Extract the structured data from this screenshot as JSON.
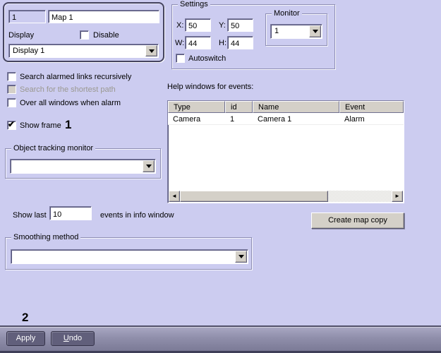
{
  "colors": {
    "background": "#ccccf0",
    "group_border_dark": "#45445f",
    "bar_gradient_top": "#a9a8c3",
    "bar_gradient_bottom": "#7b7a96",
    "bar_button_fill": "#615f7b",
    "classic_gray": "#d4d0c8",
    "disabled_text": "#9a9890"
  },
  "glyphs": {
    "check": "✔",
    "scroll_left": "◄",
    "scroll_right": "►"
  },
  "map_group": {
    "id_value": "1",
    "name_value": "Map 1",
    "display_label": "Display",
    "disable_label": "Disable",
    "display_selected": "Display 1"
  },
  "options": {
    "search_alarmed_label": "Search alarmed links recursively",
    "shortest_path_label": "Search for the shortest path",
    "over_all_windows_label": "Over all windows when alarm",
    "show_frame_label": "Show frame"
  },
  "annotations": {
    "step1": "1",
    "step2": "2"
  },
  "object_tracking": {
    "title": "Object tracking monitor",
    "selected": ""
  },
  "show_last": {
    "prefix": "Show last",
    "value": "10",
    "suffix": "events in info window"
  },
  "smoothing": {
    "title": "Smoothing method",
    "selected": ""
  },
  "settings": {
    "title": "Settings",
    "x_label": "X:",
    "x_value": "50",
    "y_label": "Y:",
    "y_value": "50",
    "w_label": "W:",
    "w_value": "44",
    "h_label": "H:",
    "h_value": "44",
    "monitor": {
      "title": "Monitor",
      "selected": "1"
    },
    "autoswitch_label": "Autoswitch"
  },
  "help_events": {
    "label": "Help windows for events:",
    "columns": [
      "Type",
      "id",
      "Name",
      "Event"
    ],
    "rows": [
      {
        "type": "Camera",
        "id": "1",
        "name": "Camera 1",
        "event": "Alarm"
      }
    ]
  },
  "actions": {
    "create_map_copy": "Create map copy",
    "apply": "Apply",
    "undo_accel": "U",
    "undo_rest": "ndo"
  }
}
